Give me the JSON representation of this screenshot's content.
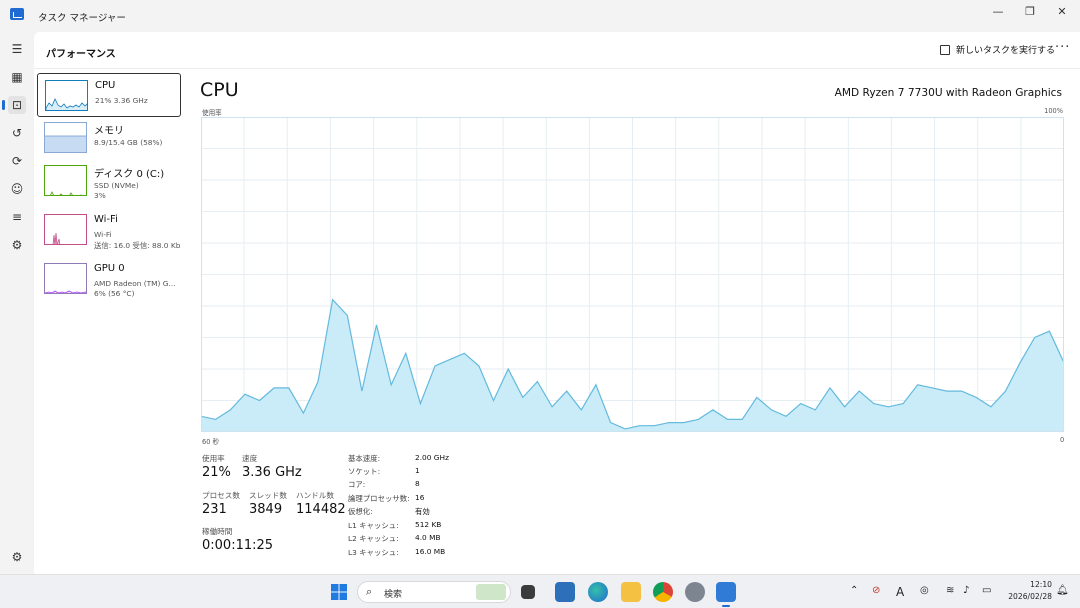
{
  "window": {
    "title": "タスク マネージャー",
    "minimize_glyph": "—",
    "restore_glyph": "❐",
    "close_glyph": "✕"
  },
  "nav_icons": [
    "hamburger-icon",
    "processes-icon",
    "performance-icon",
    "app-history-icon",
    "startup-icon",
    "users-icon",
    "details-icon",
    "services-icon",
    "settings-icon"
  ],
  "header": {
    "title": "パフォーマンス",
    "run_task_label": "新しいタスクを実行する",
    "more_label": "···"
  },
  "resources": [
    {
      "name": "CPU",
      "sub1": "21% 3.36 GHz",
      "color": "#117dbb"
    },
    {
      "name": "メモリ",
      "sub1": "8.9/15.4 GB (58%)",
      "color": "#8b12ae"
    },
    {
      "name": "ディスク 0 (C:)",
      "sub1": "SSD (NVMe)",
      "sub2": "3%",
      "color": "#4da60c"
    },
    {
      "name": "Wi-Fi",
      "sub1": "Wi-Fi",
      "sub2": "送信: 16.0 受信: 88.0 Kb",
      "color": "#a74f01"
    },
    {
      "name": "GPU 0",
      "sub1": "AMD Radeon (TM) G...",
      "sub2": "6% (56 °C)",
      "color": "#ac39ff"
    }
  ],
  "cpu": {
    "title": "CPU",
    "model": "AMD Ryzen 7 7730U with Radeon Graphics",
    "graph_label": "使用率",
    "max_label": "100%",
    "time_left_label": "60 秒",
    "time_right_label": "0",
    "stats": {
      "usage_label": "使用率",
      "usage_value": "21%",
      "speed_label": "速度",
      "speed_value": "3.36 GHz",
      "processes_label": "プロセス数",
      "processes_value": "231",
      "threads_label": "スレッド数",
      "threads_value": "3849",
      "handles_label": "ハンドル数",
      "handles_value": "114482",
      "uptime_label": "稼働時間",
      "uptime_value": "0:00:11:25"
    },
    "specs": [
      {
        "key": "基本速度:",
        "value": "2.00 GHz"
      },
      {
        "key": "ソケット:",
        "value": "1"
      },
      {
        "key": "コア:",
        "value": "8"
      },
      {
        "key": "論理プロセッサ数:",
        "value": "16"
      },
      {
        "key": "仮想化:",
        "value": "有効"
      },
      {
        "key": "L1 キャッシュ:",
        "value": "512 KB"
      },
      {
        "key": "L2 キャッシュ:",
        "value": "4.0 MB"
      },
      {
        "key": "L3 キャッシュ:",
        "value": "16.0 MB"
      }
    ]
  },
  "chart_data": {
    "type": "area",
    "title": "",
    "xlabel": "",
    "ylabel": "使用率",
    "x_range_seconds": [
      60,
      0
    ],
    "ylim": [
      0,
      100
    ],
    "grid": true,
    "values": [
      5,
      4,
      7,
      12,
      10,
      14,
      14,
      6,
      16,
      42,
      37,
      13,
      34,
      15,
      25,
      9,
      21,
      23,
      25,
      21,
      10,
      20,
      11,
      16,
      8,
      13,
      7,
      15,
      3,
      1,
      2,
      2,
      3,
      3,
      4,
      7,
      4,
      4,
      11,
      7,
      5,
      9,
      7,
      14,
      8,
      13,
      9,
      8,
      9,
      15,
      14,
      13,
      13,
      11,
      8,
      13,
      22,
      30,
      32,
      22
    ],
    "fill_color": "#c9ecf8",
    "line_color": "#64b9dd"
  },
  "taskbar": {
    "search_placeholder": "検索",
    "clock_time": "12:10",
    "clock_date": "2026/02/28",
    "ime_label": "A"
  }
}
